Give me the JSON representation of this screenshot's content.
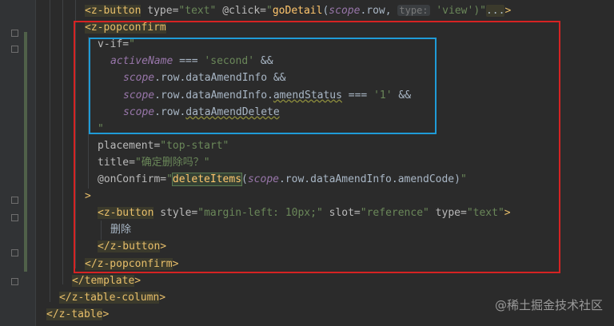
{
  "editor": {
    "lines": [
      {
        "indent": 106,
        "tokens": [
          {
            "t": "<z-button",
            "c": "tag tagbg"
          },
          {
            "t": " type=",
            "c": "attr"
          },
          {
            "t": "\"text\"",
            "c": "str"
          },
          {
            "t": " @click=",
            "c": "attr"
          },
          {
            "t": "\"",
            "c": "str"
          },
          {
            "t": "goDetail",
            "c": "method"
          },
          {
            "t": "(",
            "c": "prop"
          },
          {
            "t": "scope",
            "c": "js"
          },
          {
            "t": ".row, ",
            "c": "prop"
          },
          {
            "t": "type:",
            "c": "hint"
          },
          {
            "t": " 'view'",
            "c": "str"
          },
          {
            "t": ")\"",
            "c": "str"
          },
          {
            "t": "...",
            "c": "fold-dots"
          },
          {
            "t": ">",
            "c": "tag"
          }
        ]
      },
      {
        "indent": 106,
        "tokens": [
          {
            "t": "<z-popconfirm",
            "c": "tag tagbg"
          }
        ]
      },
      {
        "indent": 122,
        "tokens": [
          {
            "t": "v-if=",
            "c": "attr"
          },
          {
            "t": "\"",
            "c": "str"
          }
        ]
      },
      {
        "indent": 138,
        "tokens": [
          {
            "t": "activeName",
            "c": "js"
          },
          {
            "t": " === ",
            "c": "prop"
          },
          {
            "t": "'second'",
            "c": "str"
          },
          {
            "t": " &&",
            "c": "prop"
          }
        ]
      },
      {
        "indent": 154,
        "tokens": [
          {
            "t": "scope",
            "c": "js"
          },
          {
            "t": ".row.dataAmendInfo &&",
            "c": "prop"
          }
        ]
      },
      {
        "indent": 154,
        "tokens": [
          {
            "t": "scope",
            "c": "js"
          },
          {
            "t": ".row.dataAmendInfo.",
            "c": "prop"
          },
          {
            "t": "amendStatus",
            "c": "prop squiggle"
          },
          {
            "t": " === ",
            "c": "prop"
          },
          {
            "t": "'1'",
            "c": "str"
          },
          {
            "t": " &&",
            "c": "prop"
          }
        ]
      },
      {
        "indent": 154,
        "tokens": [
          {
            "t": "scope",
            "c": "js"
          },
          {
            "t": ".row.",
            "c": "prop"
          },
          {
            "t": "dataAmendDelete",
            "c": "prop squiggle"
          }
        ]
      },
      {
        "indent": 122,
        "tokens": [
          {
            "t": "\"",
            "c": "str"
          }
        ]
      },
      {
        "indent": 122,
        "tokens": [
          {
            "t": "placement=",
            "c": "attr"
          },
          {
            "t": "\"top-start\"",
            "c": "str"
          }
        ]
      },
      {
        "indent": 122,
        "tokens": [
          {
            "t": "title=",
            "c": "attr"
          },
          {
            "t": "\"确定删除吗？\"",
            "c": "str"
          }
        ]
      },
      {
        "indent": 122,
        "tokens": [
          {
            "t": "@onConfirm=",
            "c": "attr"
          },
          {
            "t": "\"",
            "c": "str"
          },
          {
            "t": "deleteItems",
            "c": "call-hl"
          },
          {
            "t": "(",
            "c": "prop"
          },
          {
            "t": "scope",
            "c": "js"
          },
          {
            "t": ".row.dataAmendInfo.amendCode)",
            "c": "prop"
          },
          {
            "t": "\"",
            "c": "str"
          }
        ]
      },
      {
        "indent": 106,
        "tokens": [
          {
            "t": ">",
            "c": "tag"
          }
        ]
      },
      {
        "indent": 122,
        "tokens": [
          {
            "t": "<z-button",
            "c": "tag tagbg"
          },
          {
            "t": " style=",
            "c": "attr"
          },
          {
            "t": "\"margin-left: 10px;\"",
            "c": "str"
          },
          {
            "t": " slot=",
            "c": "attr"
          },
          {
            "t": "\"reference\"",
            "c": "str"
          },
          {
            "t": " type=",
            "c": "attr"
          },
          {
            "t": "\"text\"",
            "c": "str"
          },
          {
            "t": ">",
            "c": "tag"
          }
        ]
      },
      {
        "indent": 138,
        "tokens": [
          {
            "t": "删除",
            "c": "prop"
          }
        ]
      },
      {
        "indent": 122,
        "tokens": [
          {
            "t": "</z-button",
            "c": "tag tagbg"
          },
          {
            "t": ">",
            "c": "tag"
          }
        ]
      },
      {
        "indent": 106,
        "tokens": [
          {
            "t": "</z-popconfirm",
            "c": "tag tagbg"
          },
          {
            "t": ">",
            "c": "tag"
          }
        ]
      },
      {
        "indent": 90,
        "tokens": [
          {
            "t": "</template",
            "c": "tag tagbg"
          },
          {
            "t": ">",
            "c": "tag"
          }
        ]
      },
      {
        "indent": 74,
        "tokens": [
          {
            "t": "</z-table-column",
            "c": "tag tagbg"
          },
          {
            "t": ">",
            "c": "tag"
          }
        ]
      },
      {
        "indent": 58,
        "tokens": [
          {
            "t": "</z-table",
            "c": "tag tagbg"
          },
          {
            "t": ">",
            "c": "tag"
          }
        ]
      }
    ]
  },
  "watermark": "@稀土掘金技术社区"
}
